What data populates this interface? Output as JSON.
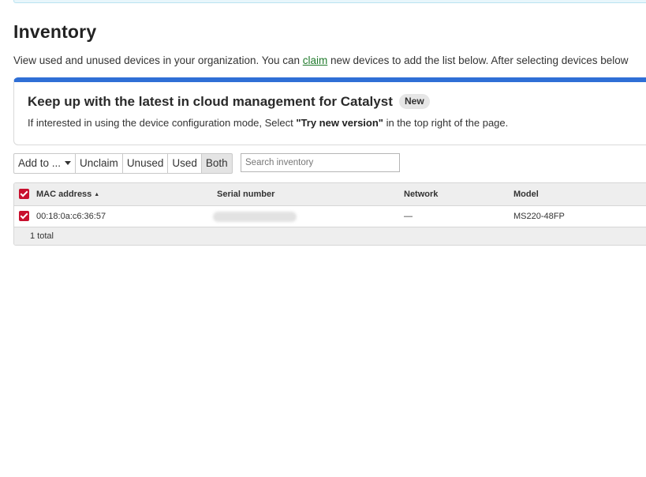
{
  "page": {
    "title": "Inventory",
    "intro_before": "View used and unused devices in your organization. You can ",
    "intro_link": "claim",
    "intro_after": " new devices to add the list below. After selecting devices below"
  },
  "promo": {
    "heading": "Keep up with the latest in cloud management for Catalyst",
    "badge": "New",
    "text_before": "If interested in using the device configuration mode, Select ",
    "text_bold": "\"Try new version\"",
    "text_after": " in the top right of the page.",
    "accent_color": "#2f6fd6"
  },
  "toolbar": {
    "add_to_label": "Add to ...",
    "unclaim_label": "Unclaim",
    "unused_label": "Unused",
    "used_label": "Used",
    "both_label": "Both",
    "active_filter": "Both"
  },
  "search": {
    "placeholder": "Search inventory",
    "value": ""
  },
  "table": {
    "columns": [
      "MAC address",
      "Serial number",
      "Network",
      "Model"
    ],
    "sort_column": "MAC address",
    "sort_direction": "ascending",
    "rows": [
      {
        "checked": true,
        "mac": "00:18:0a:c6:36:57",
        "serial": "",
        "serial_redacted": true,
        "network": "—",
        "model": "MS220-48FP"
      }
    ],
    "footer": "1 total"
  },
  "colors": {
    "checkbox": "#c8102e",
    "link": "#207a2c"
  }
}
